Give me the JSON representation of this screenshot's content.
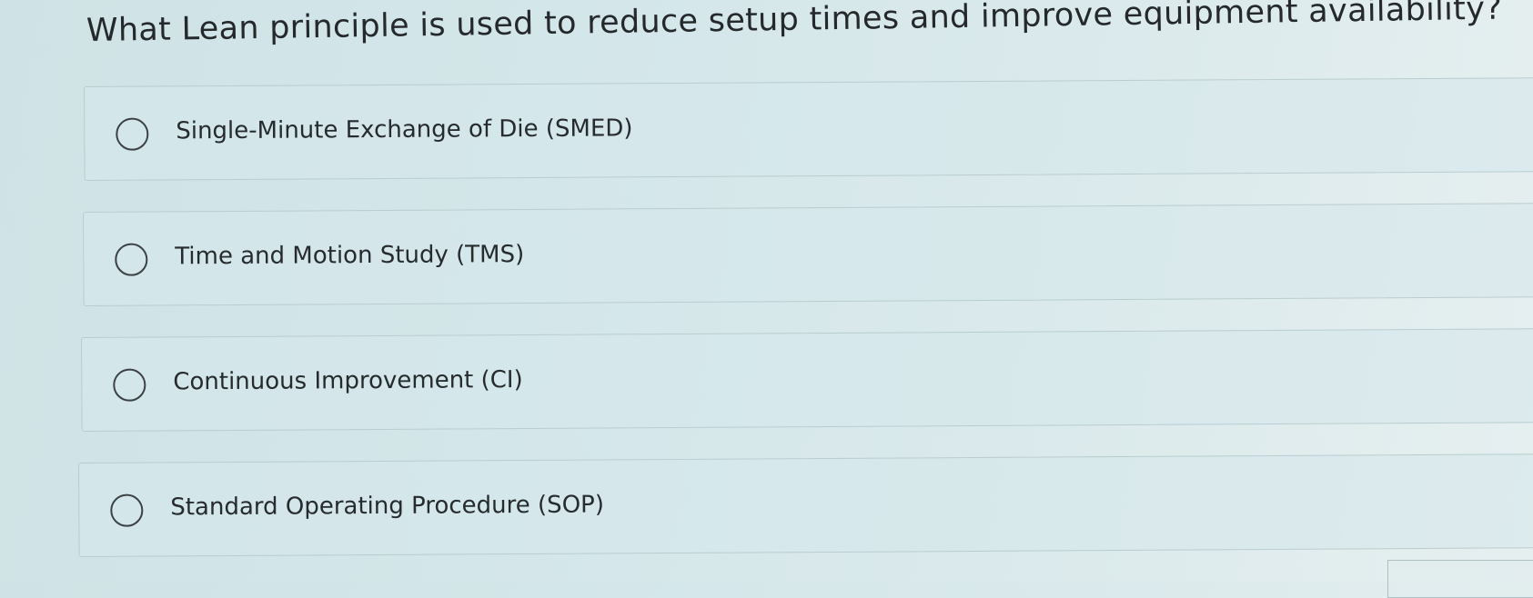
{
  "question": {
    "text": "What Lean principle is used to reduce setup times and improve equipment availability?"
  },
  "options": [
    {
      "label": "Single-Minute Exchange of Die (SMED)",
      "selected": false
    },
    {
      "label": "Time and Motion Study (TMS)",
      "selected": false
    },
    {
      "label": "Continuous Improvement (CI)",
      "selected": false
    },
    {
      "label": "Standard Operating Procedure (SOP)",
      "selected": false
    }
  ]
}
